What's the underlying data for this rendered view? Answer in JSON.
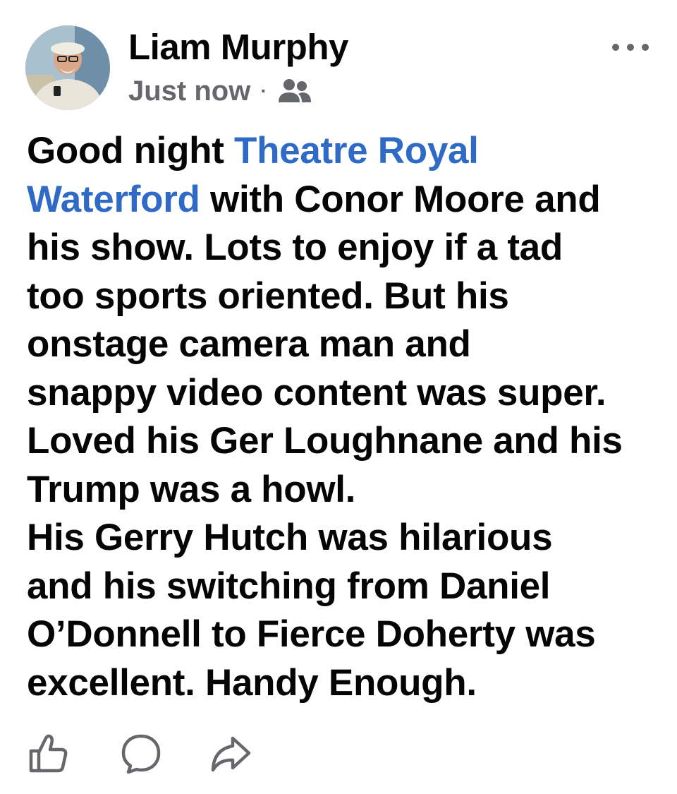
{
  "post": {
    "author_name": "Liam Murphy",
    "timestamp": "Just now",
    "separator": "·",
    "audience_icon": "friends-icon",
    "more_icon": "more-options-icon",
    "body_lines": [
      [
        {
          "text": "Good night ",
          "link": false
        },
        {
          "text": "Theatre Royal",
          "link": true
        }
      ],
      [
        {
          "text": "Waterford",
          "link": true
        },
        {
          "text": " with Conor Moore and",
          "link": false
        }
      ],
      [
        {
          "text": "his show. Lots to enjoy if a tad",
          "link": false
        }
      ],
      [
        {
          "text": "too sports oriented. But his",
          "link": false
        }
      ],
      [
        {
          "text": "onstage camera man and",
          "link": false
        }
      ],
      [
        {
          "text": "snappy video content was super.",
          "link": false
        }
      ],
      [
        {
          "text": "Loved his Ger Loughnane and his",
          "link": false
        }
      ],
      [
        {
          "text": "Trump was a howl.",
          "link": false
        }
      ],
      [
        {
          "text": "His Gerry Hutch was hilarious",
          "link": false
        }
      ],
      [
        {
          "text": "and his switching from Daniel",
          "link": false
        }
      ],
      [
        {
          "text": "O’Donnell to Fierce Doherty was",
          "link": false
        }
      ],
      [
        {
          "text": "excellent. Handy Enough.",
          "link": false
        }
      ]
    ],
    "link_color": "#2f6ac6",
    "secondary_color": "#65676b"
  },
  "actions": [
    {
      "name": "like",
      "icon": "thumbs-up-icon"
    },
    {
      "name": "comment",
      "icon": "comment-bubble-icon"
    },
    {
      "name": "share",
      "icon": "share-arrow-icon"
    }
  ]
}
